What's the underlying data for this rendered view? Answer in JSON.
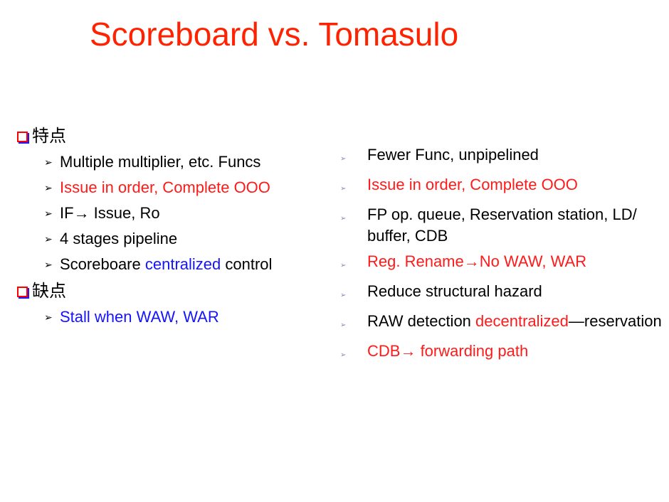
{
  "title": "Scoreboard vs. Tomasulo",
  "left": {
    "features_heading": "特点",
    "features": {
      "f1": "Multiple  multiplier, etc. Funcs",
      "f2": "Issue in order, Complete OOO",
      "f3_a": "IF",
      "f3_arrow": "→",
      "f3_b": " Issue, Ro",
      "f4": "4 stages pipeline",
      "f5_a": "Scoreboare ",
      "f5_b": "centralized",
      "f5_c": " control"
    },
    "drawbacks_heading": "缺点",
    "drawbacks": {
      "d1": "Stall when WAW, WAR"
    }
  },
  "right": {
    "r1": "Fewer Func, unpipelined",
    "r2": "Issue in order, Complete OOO",
    "r3_line1": "FP op. queue, Reservation station, LD/",
    "r3_line2": "buffer, CDB",
    "r4_a": "Reg. Rename",
    "r4_arrow": "→",
    "r4_b": "No WAW, WAR",
    "r5": "Reduce structural hazard",
    "r6_a": "RAW detection ",
    "r6_b": "decentralized",
    "r6_c": "—reservation",
    "r7_a": "CDB",
    "r7_arrow": "→",
    "r7_b": " forwarding path"
  },
  "colors": {
    "title": "#ff2200",
    "red": "#ff1a1a",
    "blue": "#1414ff"
  },
  "icons": {
    "section_bullet": "hollow-square-icon",
    "item_bullet": "arrowhead-icon"
  }
}
